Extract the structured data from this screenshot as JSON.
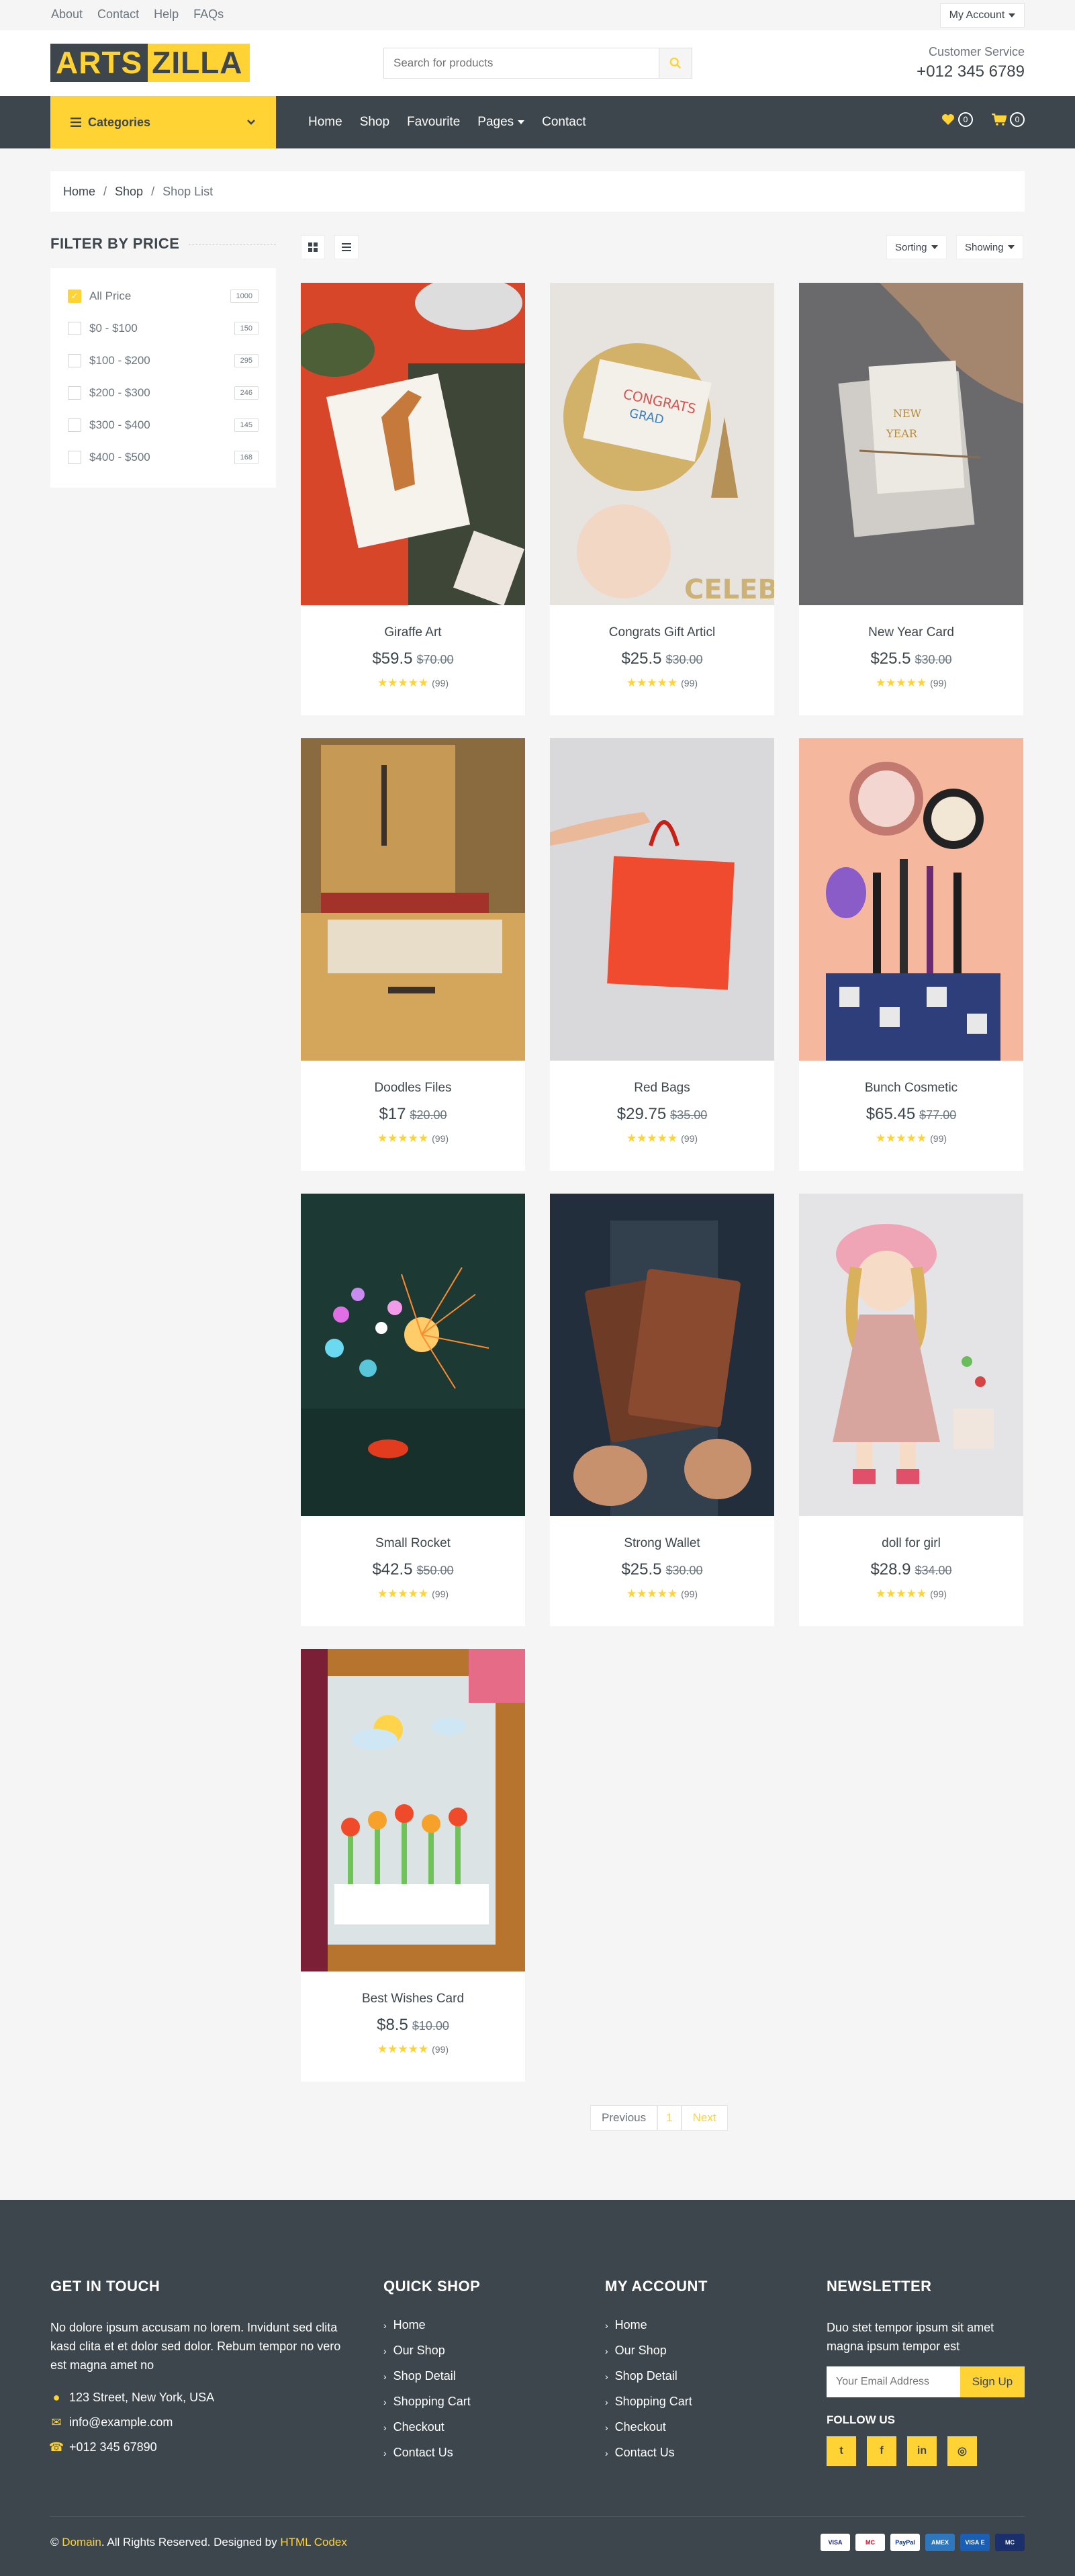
{
  "topbar": {
    "links": [
      "About",
      "Contact",
      "Help",
      "FAQs"
    ],
    "account": "My Account"
  },
  "header": {
    "logo_a": "ARTS",
    "logo_b": "ZILLA",
    "search_placeholder": "Search for products",
    "service_label": "Customer Service",
    "service_phone": "+012 345 6789"
  },
  "nav": {
    "categories": "Categories",
    "items": [
      "Home",
      "Shop",
      "Favourite",
      "Pages",
      "Contact"
    ],
    "wish_count": "0",
    "cart_count": "0"
  },
  "breadcrumb": [
    "Home",
    "Shop",
    "Shop List"
  ],
  "filter": {
    "title": "FILTER BY PRICE",
    "options": [
      {
        "label": "All Price",
        "count": "1000"
      },
      {
        "label": "$0 - $100",
        "count": "150"
      },
      {
        "label": "$100 - $200",
        "count": "295"
      },
      {
        "label": "$200 - $300",
        "count": "246"
      },
      {
        "label": "$300 - $400",
        "count": "145"
      },
      {
        "label": "$400 - $500",
        "count": "168"
      }
    ]
  },
  "toolbar": {
    "sorting": "Sorting",
    "showing": "Showing"
  },
  "products": [
    {
      "name": "Giraffe Art",
      "price": "$59.5",
      "old": "$70.00",
      "reviews": "(99)"
    },
    {
      "name": "Congrats Gift Articl",
      "price": "$25.5",
      "old": "$30.00",
      "reviews": "(99)"
    },
    {
      "name": "New Year Card",
      "price": "$25.5",
      "old": "$30.00",
      "reviews": "(99)"
    },
    {
      "name": "Doodles Files",
      "price": "$17",
      "old": "$20.00",
      "reviews": "(99)"
    },
    {
      "name": "Red Bags",
      "price": "$29.75",
      "old": "$35.00",
      "reviews": "(99)"
    },
    {
      "name": "Bunch Cosmetic",
      "price": "$65.45",
      "old": "$77.00",
      "reviews": "(99)"
    },
    {
      "name": "Small Rocket",
      "price": "$42.5",
      "old": "$50.00",
      "reviews": "(99)"
    },
    {
      "name": "Strong Wallet",
      "price": "$25.5",
      "old": "$30.00",
      "reviews": "(99)"
    },
    {
      "name": "doll for girl",
      "price": "$28.9",
      "old": "$34.00",
      "reviews": "(99)"
    },
    {
      "name": "Best Wishes Card",
      "price": "$8.5",
      "old": "$10.00",
      "reviews": "(99)"
    }
  ],
  "pager": {
    "prev": "Previous",
    "current": "1",
    "next": "Next"
  },
  "footer": {
    "touch_title": "GET IN TOUCH",
    "touch_text": "No dolore ipsum accusam no lorem. Invidunt sed clita kasd clita et et dolor sed dolor. Rebum tempor no vero est magna amet no",
    "address": "123 Street, New York, USA",
    "email": "info@example.com",
    "phone": "+012 345 67890",
    "quick_title": "QUICK SHOP",
    "quick": [
      "Home",
      "Our Shop",
      "Shop Detail",
      "Shopping Cart",
      "Checkout",
      "Contact Us"
    ],
    "account_title": "MY ACCOUNT",
    "account": [
      "Home",
      "Our Shop",
      "Shop Detail",
      "Shopping Cart",
      "Checkout",
      "Contact Us"
    ],
    "news_title": "NEWSLETTER",
    "news_text": "Duo stet tempor ipsum sit amet magna ipsum tempor est",
    "news_placeholder": "Your Email Address",
    "news_btn": "Sign Up",
    "follow": "FOLLOW US",
    "copy_a": "©",
    "copy_domain": "Domain",
    "copy_b": ". All Rights Reserved. Designed by",
    "copy_codex": "HTML Codex",
    "pay": [
      "VISA",
      "MC",
      "PayPal",
      "AMEX",
      "VISA E",
      "MC"
    ]
  },
  "colors": {
    "accent": "#ffd333",
    "dark": "#3d464d"
  }
}
